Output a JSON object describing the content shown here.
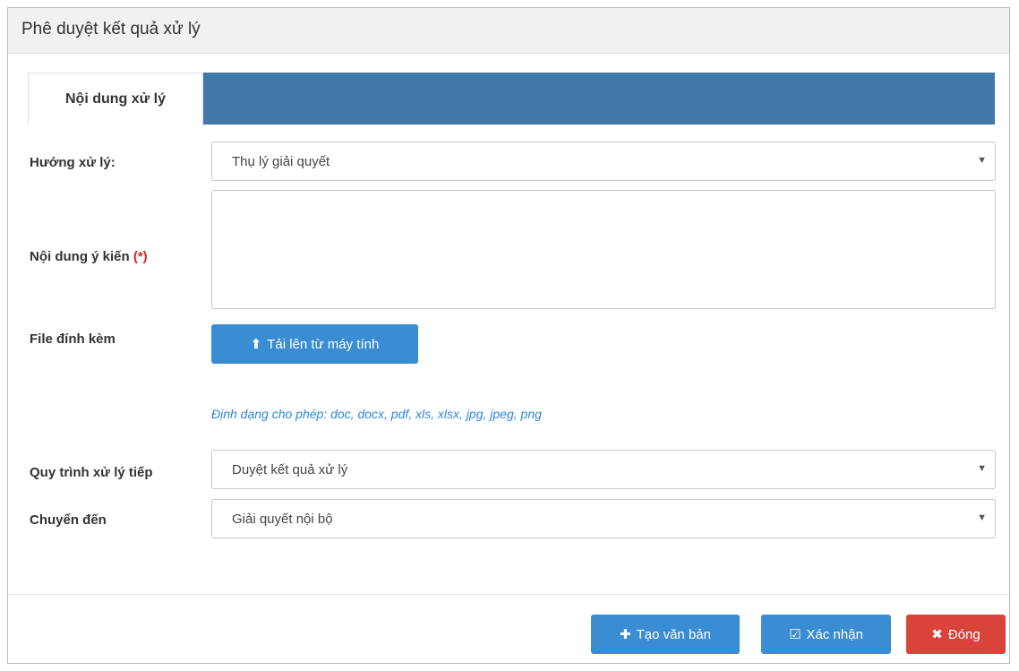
{
  "dialog": {
    "title": "Phê duyệt kết quả xử lý"
  },
  "tabs": [
    {
      "label": "Nội dung xử lý"
    }
  ],
  "form": {
    "huong_xu_ly": {
      "label": "Hướng xử lý:",
      "value": "Thụ lý giải quyết"
    },
    "noi_dung_y_kien": {
      "label": "Nội dung ý kiến ",
      "required_mark": "(*)",
      "value": ""
    },
    "file_dinh_kem": {
      "label": "File đính kèm",
      "upload_label": "Tải lên từ máy tính",
      "hint": "Định dạng cho phép: doc, docx, pdf, xls, xlsx, jpg, jpeg, png"
    },
    "quy_trinh": {
      "label": "Quy trình xử lý tiếp",
      "value": "Duyệt kết quả xử lý"
    },
    "chuyen_den": {
      "label": "Chuyển đến",
      "value": "Giải quyết nội bộ"
    }
  },
  "footer": {
    "create_label": "Tạo văn bản",
    "confirm_label": "Xác nhận",
    "close_label": "Đóng"
  },
  "colors": {
    "tab_bar": "#3f79a9",
    "primary": "#3b8dd3",
    "danger": "#d9433a",
    "hint": "#2e86d9"
  }
}
